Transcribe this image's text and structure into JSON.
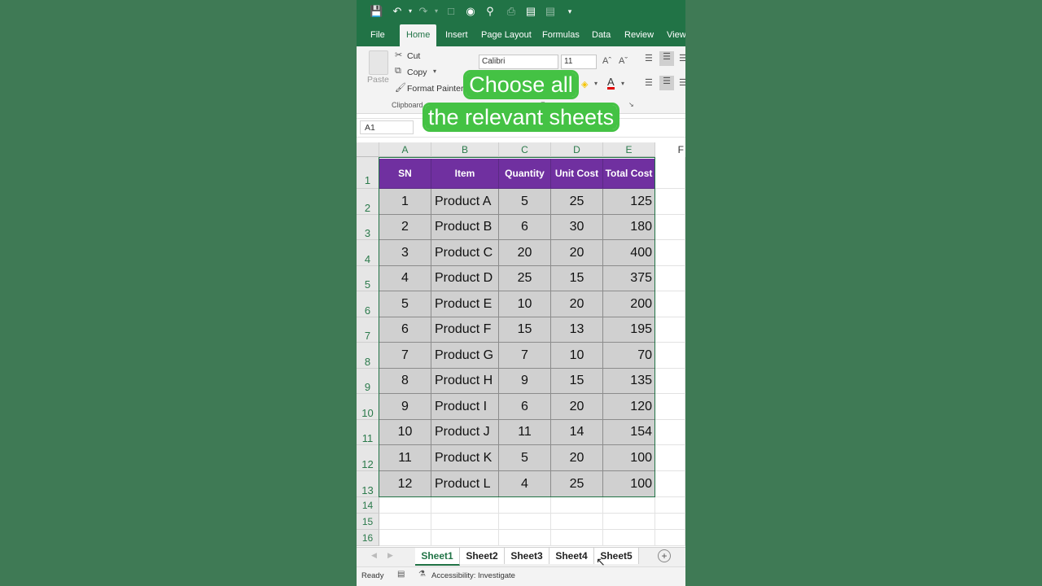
{
  "ribbon": {
    "tabs": [
      "File",
      "Home",
      "Insert",
      "Page Layout",
      "Formulas",
      "Data",
      "Review",
      "View"
    ],
    "active_tab": "Home",
    "clipboard": {
      "paste": "Paste",
      "cut": "Cut",
      "copy": "Copy",
      "format_painter": "Format Painter",
      "group": "Clipboard"
    },
    "font": {
      "name": "Calibri",
      "size": "11",
      "group": "Font"
    }
  },
  "name_box": "A1",
  "overlay": {
    "line1": "Choose all",
    "line2": "the relevant sheets"
  },
  "columns": [
    "A",
    "B",
    "C",
    "D",
    "E",
    "F"
  ],
  "table": {
    "headers": [
      "SN",
      "Item",
      "Quantity",
      "Unit Cost",
      "Total Cost"
    ],
    "rows": [
      [
        "1",
        "Product A",
        "5",
        "25",
        "125"
      ],
      [
        "2",
        "Product B",
        "6",
        "30",
        "180"
      ],
      [
        "3",
        "Product C",
        "20",
        "20",
        "400"
      ],
      [
        "4",
        "Product D",
        "25",
        "15",
        "375"
      ],
      [
        "5",
        "Product E",
        "10",
        "20",
        "200"
      ],
      [
        "6",
        "Product F",
        "15",
        "13",
        "195"
      ],
      [
        "7",
        "Product G",
        "7",
        "10",
        "70"
      ],
      [
        "8",
        "Product H",
        "9",
        "15",
        "135"
      ],
      [
        "9",
        "Product I",
        "6",
        "20",
        "120"
      ],
      [
        "10",
        "Product J",
        "11",
        "14",
        "154"
      ],
      [
        "11",
        "Product K",
        "5",
        "20",
        "100"
      ],
      [
        "12",
        "Product L",
        "4",
        "25",
        "100"
      ]
    ]
  },
  "row_numbers": [
    "1",
    "2",
    "3",
    "4",
    "5",
    "6",
    "7",
    "8",
    "9",
    "10",
    "11",
    "12",
    "13",
    "14",
    "15",
    "16"
  ],
  "sheets": [
    "Sheet1",
    "Sheet2",
    "Sheet3",
    "Sheet4",
    "Sheet5"
  ],
  "active_sheet": "Sheet1",
  "status": {
    "ready": "Ready",
    "accessibility": "Accessibility: Investigate"
  },
  "colors": {
    "excel_green": "#217346",
    "header_purple": "#7030a0",
    "overlay_green": "#44c244",
    "background": "#3f7a55"
  }
}
